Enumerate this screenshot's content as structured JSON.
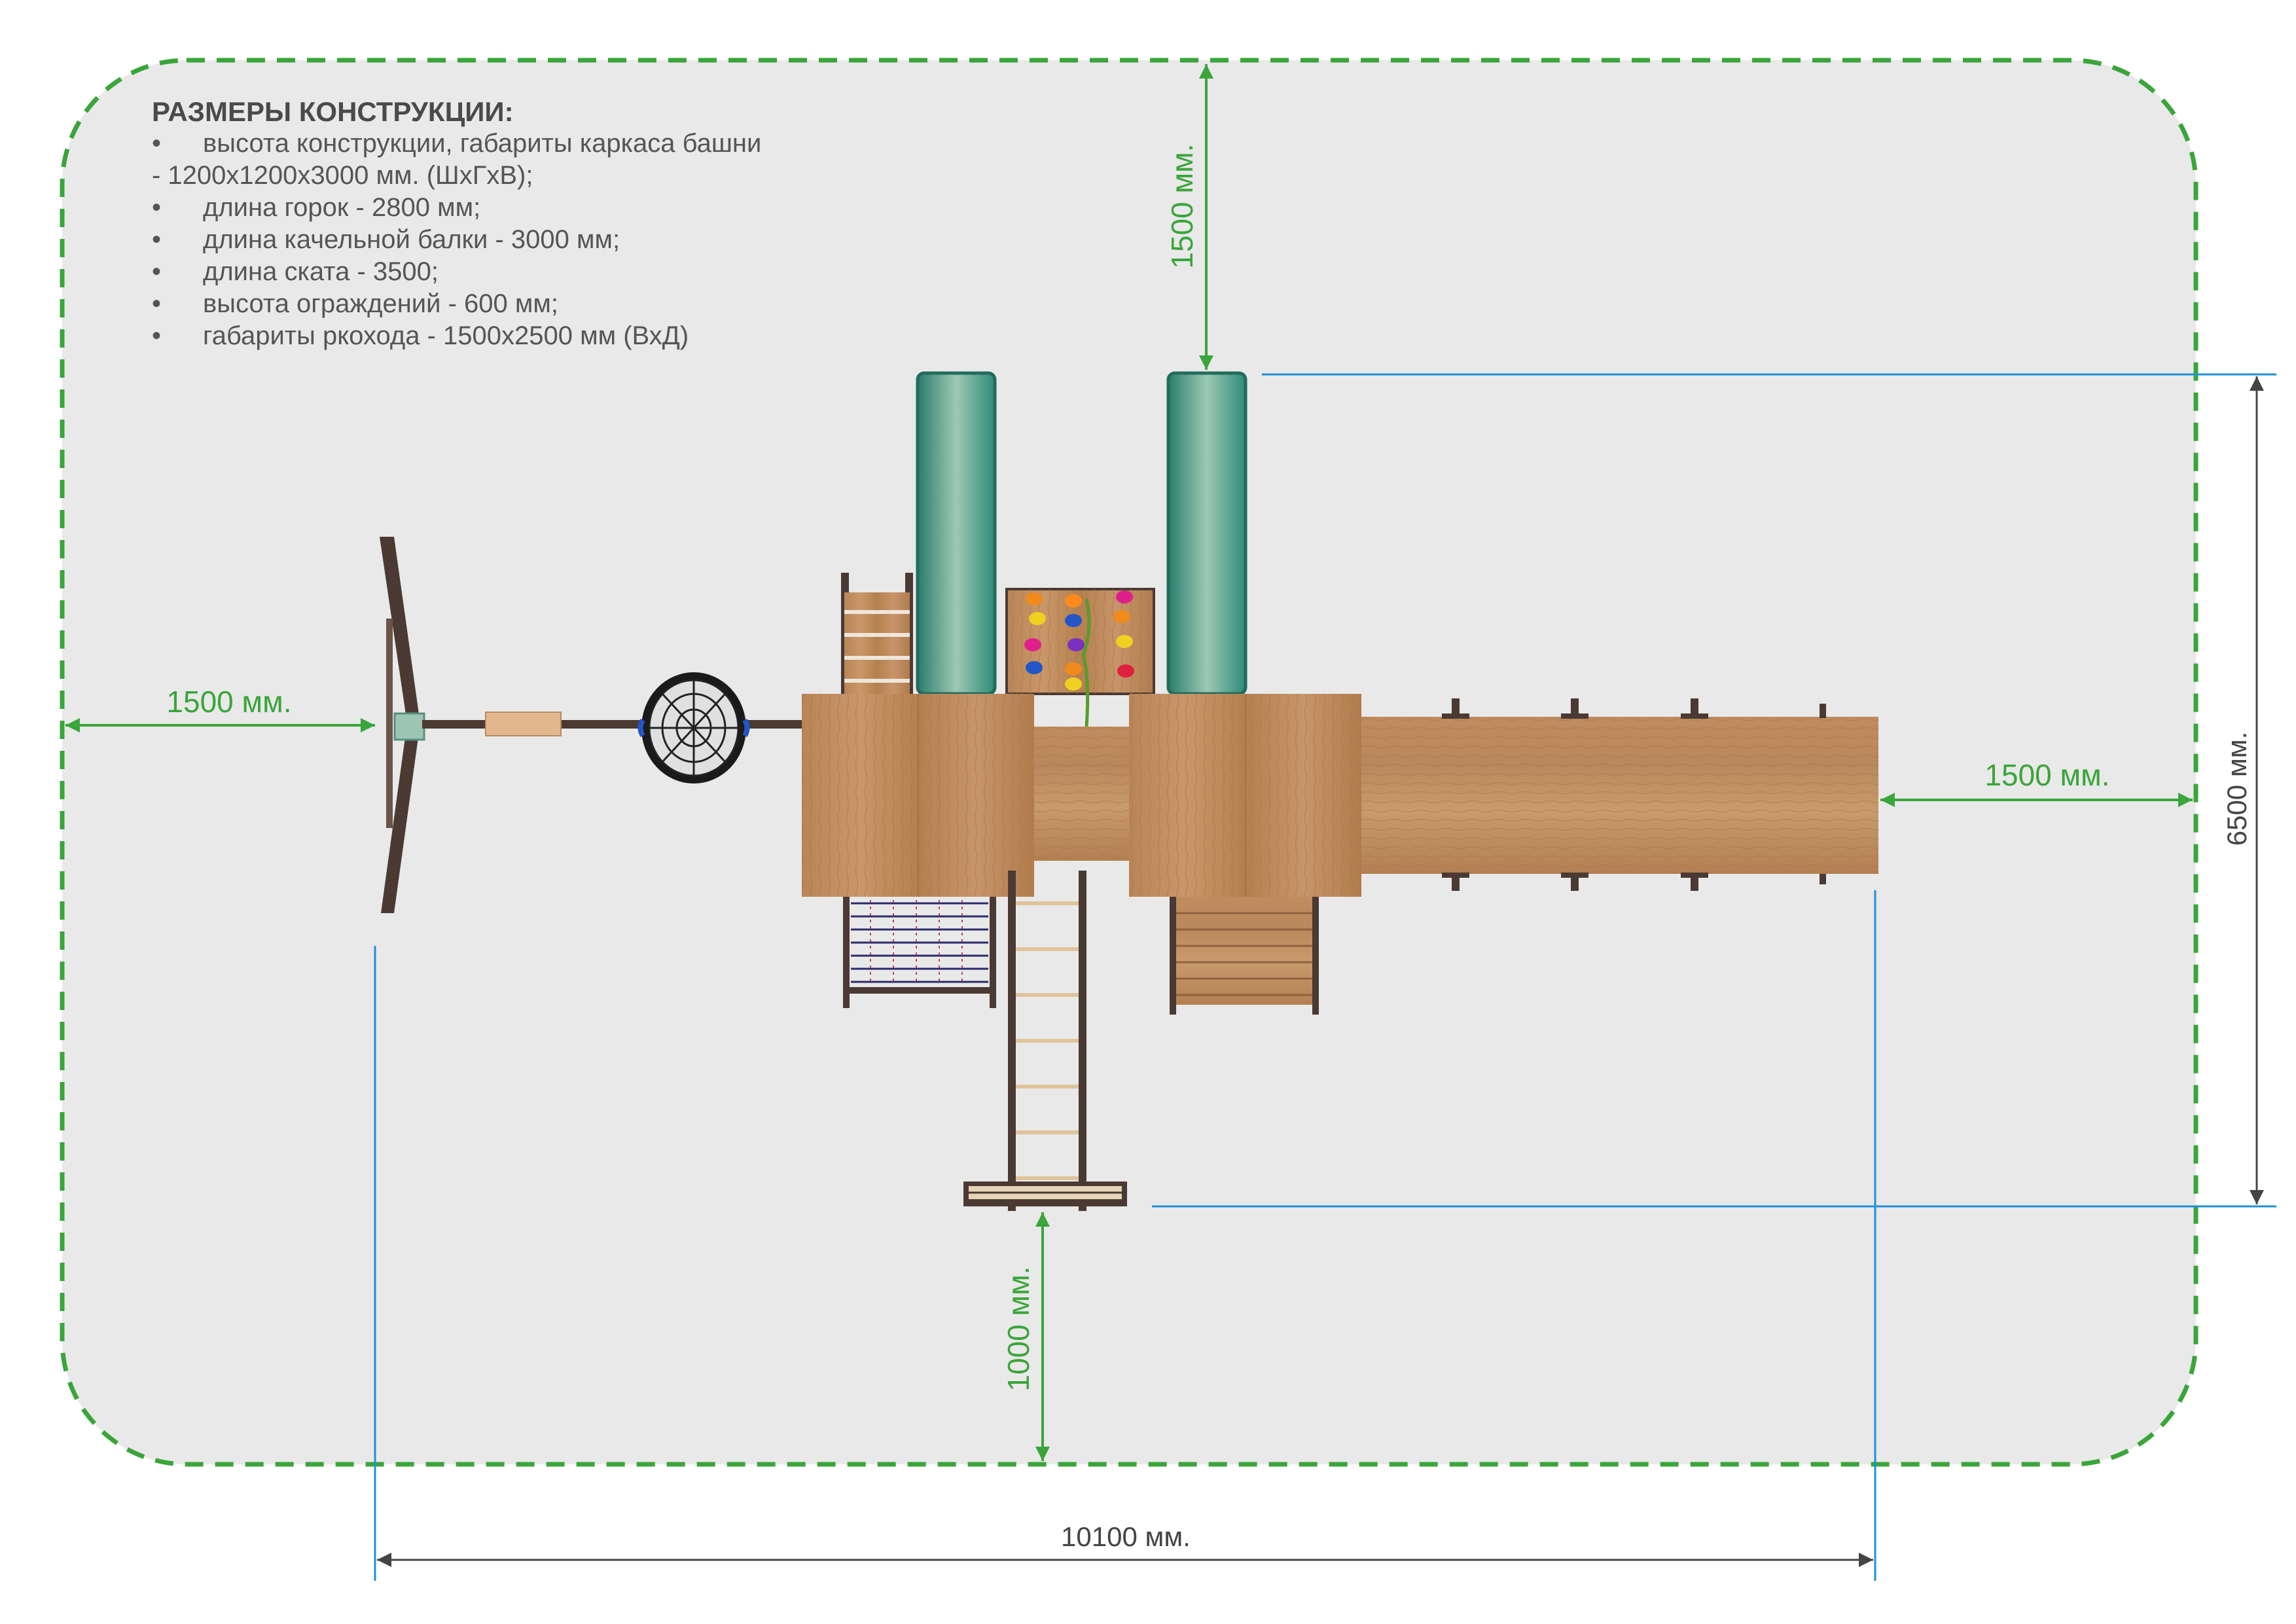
{
  "notes": {
    "title": "РАЗМЕРЫ КОНСТРУКЦИИ:",
    "bullet": "•",
    "lines": [
      {
        "bullet": true,
        "text": "высота конструкции, габариты каркаса башни"
      },
      {
        "bullet": false,
        "text": "- 1200x1200x3000 мм. (ШхГхВ);"
      },
      {
        "bullet": true,
        "text": "длина горок - 2800 мм;"
      },
      {
        "bullet": true,
        "text": "длина качельной балки - 3000 мм;"
      },
      {
        "bullet": true,
        "text": "длина ската - 3500;"
      },
      {
        "bullet": true,
        "text": "высота ограждений - 600 мм;"
      },
      {
        "bullet": true,
        "text": "габариты ркохода - 1500x2500 мм (ВхД)"
      }
    ]
  },
  "dimensions": {
    "top_clearance": "1500 мм.",
    "left_clearance": "1500 мм.",
    "right_clearance": "1500 мм.",
    "bottom_clearance": "1000 мм.",
    "total_depth": "6500 мм.",
    "total_length": "10100 мм."
  },
  "colors": {
    "background": "#e9e9e9",
    "safety_zone": "#3aa53a",
    "dimension_green": "#3aa53a",
    "dimension_blue": "#1e90d8",
    "slide": "#2f8b79",
    "wood": "#c08a5e",
    "dark_frame": "#4a3a33"
  }
}
